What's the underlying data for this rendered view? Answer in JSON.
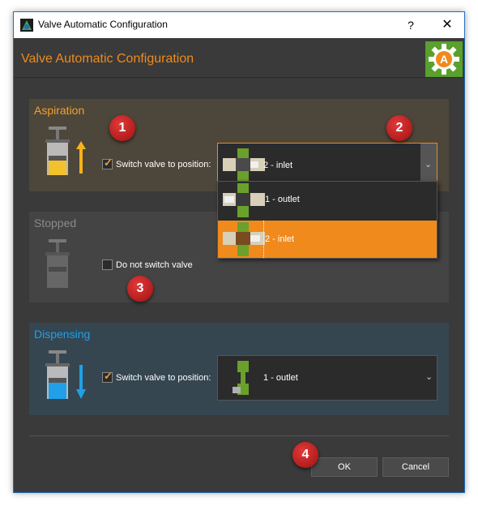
{
  "window": {
    "title": "Valve Automatic Configuration",
    "help_label": "?",
    "close_label": "✕"
  },
  "header": {
    "title": "Valve Automatic Configuration",
    "logo_letter": "A"
  },
  "aspiration": {
    "title": "Aspiration",
    "checkbox_checked": true,
    "checkbox_label": "Switch valve to position:",
    "selected": "2 - inlet",
    "dropdown_open": true,
    "options": [
      "1 - outlet",
      "2 - inlet"
    ],
    "highlighted_option": "2 - inlet",
    "accent": "#f08a1c"
  },
  "stopped": {
    "title": "Stopped",
    "checkbox_checked": false,
    "checkbox_label": "Do not switch valve"
  },
  "dispensing": {
    "title": "Dispensing",
    "checkbox_checked": true,
    "checkbox_label": "Switch valve to position:",
    "selected": "1 - outlet",
    "accent": "#1fa0e8"
  },
  "buttons": {
    "ok": "OK",
    "cancel": "Cancel"
  },
  "badges": [
    "1",
    "2",
    "3",
    "4"
  ],
  "icons": [
    "app-icon",
    "auto-config-gear-icon",
    "syringe-icon",
    "arrow-up-icon",
    "arrow-down-icon",
    "valve-icon",
    "chevron-down-icon"
  ]
}
